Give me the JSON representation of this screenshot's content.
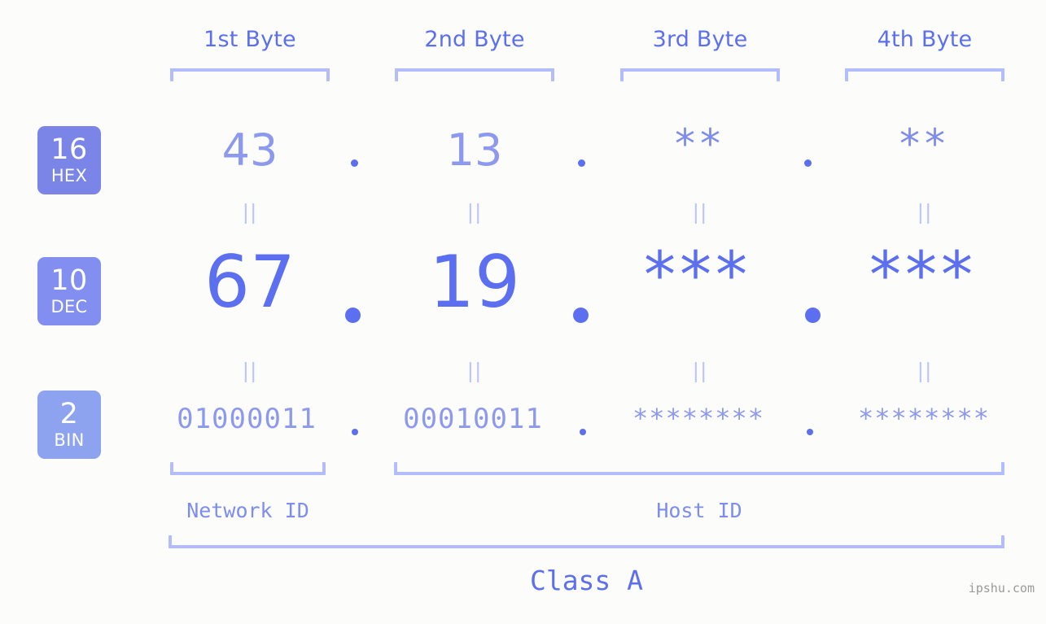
{
  "headers": [
    {
      "label": "1st Byte"
    },
    {
      "label": "2nd Byte"
    },
    {
      "label": "3rd Byte"
    },
    {
      "label": "4th Byte"
    }
  ],
  "bases": [
    {
      "num": "16",
      "name": "HEX",
      "color": "#7b85e8"
    },
    {
      "num": "10",
      "name": "DEC",
      "color": "#828ff0"
    },
    {
      "num": "2",
      "name": "BIN",
      "color": "#8ea3f0"
    }
  ],
  "rows": {
    "hex": {
      "values": [
        "43",
        "13",
        "**",
        "**"
      ]
    },
    "dec": {
      "values": [
        "67",
        "19",
        "***",
        "***"
      ]
    },
    "bin": {
      "values": [
        "01000011",
        "00010011",
        "********",
        "********"
      ]
    }
  },
  "separators": {
    "equals": "||",
    "dot": "."
  },
  "footer": {
    "network_id": "Network ID",
    "host_id": "Host ID",
    "class": "Class A",
    "watermark": "ipshu.com"
  },
  "colors": {
    "background": "#fcfdfa",
    "accent_strong": "#5b6ff0",
    "accent_light": "#8c99ef",
    "bracket": "#b3bdfb",
    "equals": "#bcc5fb"
  }
}
